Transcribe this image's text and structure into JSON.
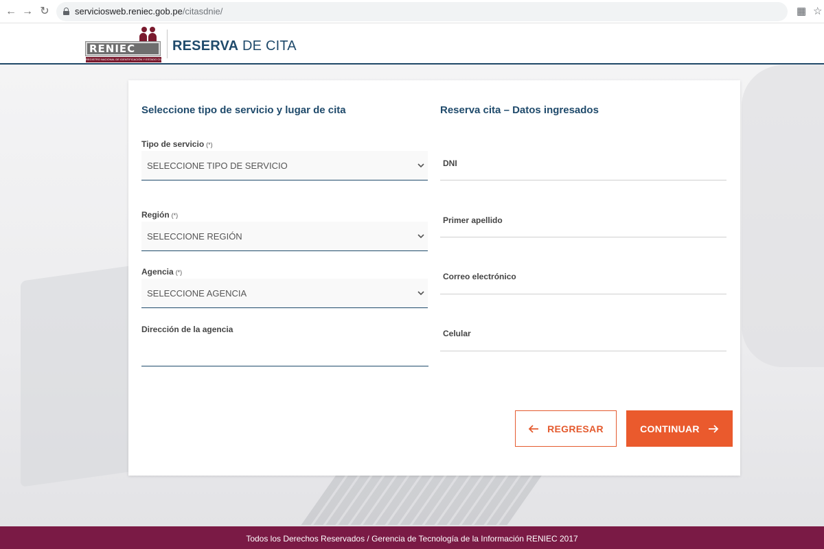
{
  "browser": {
    "url_host": "serviciosweb.reniec.gob.pe",
    "url_path": "/citasdnie/"
  },
  "header": {
    "logo_text": "RENIEC",
    "logo_tagline": "REGISTRO NACIONAL DE IDENTIFICACIÓN Y ESTADO CIVIL",
    "title_bold": "RESERVA",
    "title_rest": " DE CITA"
  },
  "left": {
    "title": "Seleccione tipo de servicio y lugar de cita",
    "tipo_label": "Tipo de servicio",
    "tipo_value": "SELECCIONE TIPO DE SERVICIO",
    "region_label": "Región",
    "region_value": "SELECCIONE REGIÓN",
    "agencia_label": "Agencia",
    "agencia_value": "SELECCIONE AGENCIA",
    "direccion_label": "Dirección de la agencia",
    "required_mark": "(*)"
  },
  "right": {
    "title": "Reserva cita – Datos ingresados",
    "dni_label": "DNI",
    "apellido_label": "Primer apellido",
    "correo_label": "Correo electrónico",
    "celular_label": "Celular"
  },
  "buttons": {
    "back_label": "REGRESAR",
    "next_label": "CONTINUAR"
  },
  "footer": {
    "text": "Todos los Derechos Reservados / Gerencia de Tecnología de la Información RENIEC 2017"
  },
  "colors": {
    "primary_blue": "#1f4a6b",
    "accent_orange": "#ea5a2d",
    "footer_wine": "#7a1a45"
  }
}
